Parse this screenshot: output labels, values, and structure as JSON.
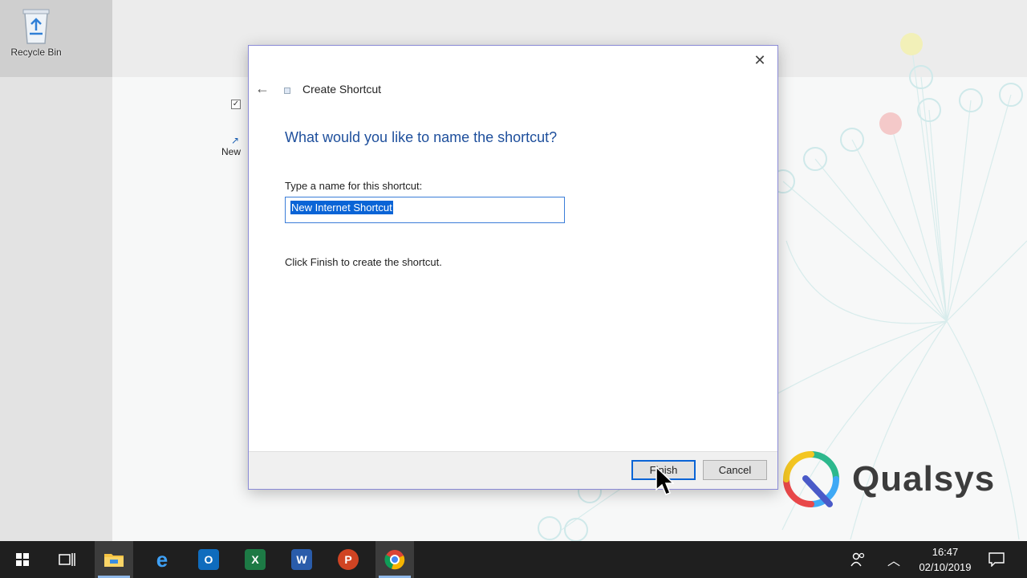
{
  "desktop": {
    "recycle_bin_label": "Recycle Bin",
    "peek_item_label": "New"
  },
  "brand": {
    "name": "Qualsys"
  },
  "dialog": {
    "title": "Create Shortcut",
    "heading": "What would you like to name the shortcut?",
    "field_label": "Type a name for this shortcut:",
    "name_value": "New Internet Shortcut",
    "hint": "Click Finish to create the shortcut.",
    "finish_label": "Finish",
    "cancel_label": "Cancel",
    "close_glyph": "✕",
    "back_glyph": "←"
  },
  "taskbar": {
    "apps": [
      "start",
      "task-view",
      "file-explorer",
      "edge",
      "outlook",
      "excel",
      "word",
      "powerpoint",
      "chrome"
    ],
    "active_app": "file-explorer",
    "time": "16:47",
    "date": "02/10/2019"
  },
  "colors": {
    "heading_blue": "#1e4f9c",
    "selection_blue": "#0a64d6",
    "taskbar": "#1f1f1f"
  }
}
